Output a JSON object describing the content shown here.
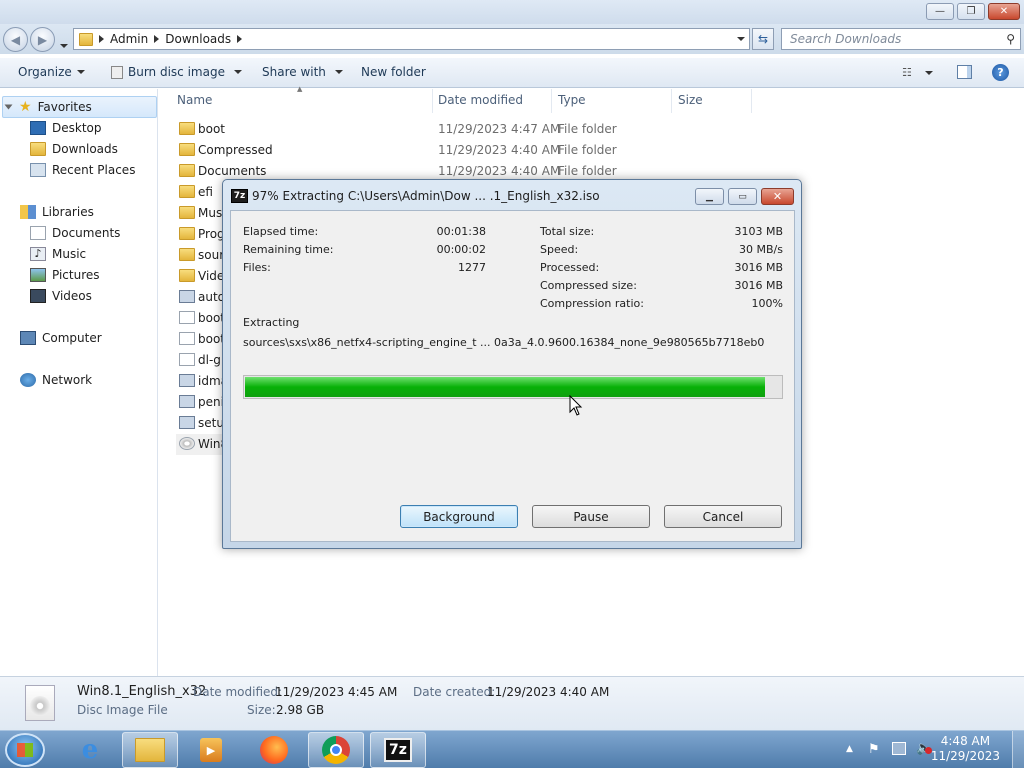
{
  "window": {
    "controls": {
      "minimize": "—",
      "maximize": "❐",
      "close": "✕"
    }
  },
  "nav": {
    "breadcrumb": [
      "Admin",
      "Downloads"
    ],
    "search_placeholder": "Search Downloads"
  },
  "toolbar": {
    "organize": "Organize",
    "burn": "Burn disc image",
    "share": "Share with",
    "new_folder": "New folder"
  },
  "sidebar": {
    "favorites": "Favorites",
    "fav_items": [
      "Desktop",
      "Downloads",
      "Recent Places"
    ],
    "libraries": "Libraries",
    "lib_items": [
      "Documents",
      "Music",
      "Pictures",
      "Videos"
    ],
    "computer": "Computer",
    "network": "Network"
  },
  "columns": {
    "name": "Name",
    "date": "Date modified",
    "type": "Type",
    "size": "Size"
  },
  "files": [
    {
      "name": "boot",
      "date": "11/29/2023 4:47 AM",
      "type": "File folder",
      "icon": "folder"
    },
    {
      "name": "Compressed",
      "date": "11/29/2023 4:40 AM",
      "type": "File folder",
      "icon": "folder"
    },
    {
      "name": "Documents",
      "date": "11/29/2023 4:40 AM",
      "type": "File folder",
      "icon": "folder"
    },
    {
      "name": "efi",
      "date": "",
      "type": "",
      "icon": "folder"
    },
    {
      "name": "Mus",
      "date": "",
      "type": "",
      "icon": "folder"
    },
    {
      "name": "Prog",
      "date": "",
      "type": "",
      "icon": "folder"
    },
    {
      "name": "sour",
      "date": "",
      "type": "",
      "icon": "folder"
    },
    {
      "name": "Vide",
      "date": "",
      "type": "",
      "icon": "folder"
    },
    {
      "name": "auto",
      "date": "",
      "type": "",
      "icon": "settings"
    },
    {
      "name": "boot",
      "date": "",
      "type": "",
      "icon": "file"
    },
    {
      "name": "boot",
      "date": "",
      "type": "",
      "icon": "file"
    },
    {
      "name": "dl-g",
      "date": "",
      "type": "",
      "icon": "file"
    },
    {
      "name": "idma",
      "date": "",
      "type": "",
      "icon": "app"
    },
    {
      "name": "peni",
      "date": "",
      "type": "",
      "icon": "app"
    },
    {
      "name": "setu",
      "date": "",
      "type": "",
      "icon": "app"
    },
    {
      "name": "Win8",
      "date": "",
      "type": "",
      "icon": "disc"
    }
  ],
  "details": {
    "filename": "Win8.1_English_x32",
    "filetype": "Disc Image File",
    "date_modified_label": "Date modified:",
    "date_modified": "11/29/2023 4:45 AM",
    "date_created_label": "Date created:",
    "date_created": "11/29/2023 4:40 AM",
    "size_label": "Size:",
    "size": "2.98 GB"
  },
  "dialog": {
    "logo": "7z",
    "title": "97% Extracting C:\\Users\\Admin\\Dow ... .1_English_x32.iso",
    "elapsed_label": "Elapsed time:",
    "elapsed": "00:01:38",
    "remaining_label": "Remaining time:",
    "remaining": "00:00:02",
    "files_label": "Files:",
    "files": "1277",
    "total_label": "Total size:",
    "total": "3103 MB",
    "speed_label": "Speed:",
    "speed": "30 MB/s",
    "processed_label": "Processed:",
    "processed": "3016 MB",
    "compressed_label": "Compressed size:",
    "compressed": "3016 MB",
    "ratio_label": "Compression ratio:",
    "ratio": "100%",
    "extracting_label": "Extracting",
    "current_file": "sources\\sxs\\x86_netfx4-scripting_engine_t ... 0a3a_4.0.9600.16384_none_9e980565b7718eb0",
    "progress": 0.97,
    "buttons": {
      "background": "Background",
      "pause": "Pause",
      "cancel": "Cancel"
    }
  },
  "taskbar": {
    "time": "4:48 AM",
    "date": "11/29/2023",
    "sevenzip_label": "7z"
  }
}
